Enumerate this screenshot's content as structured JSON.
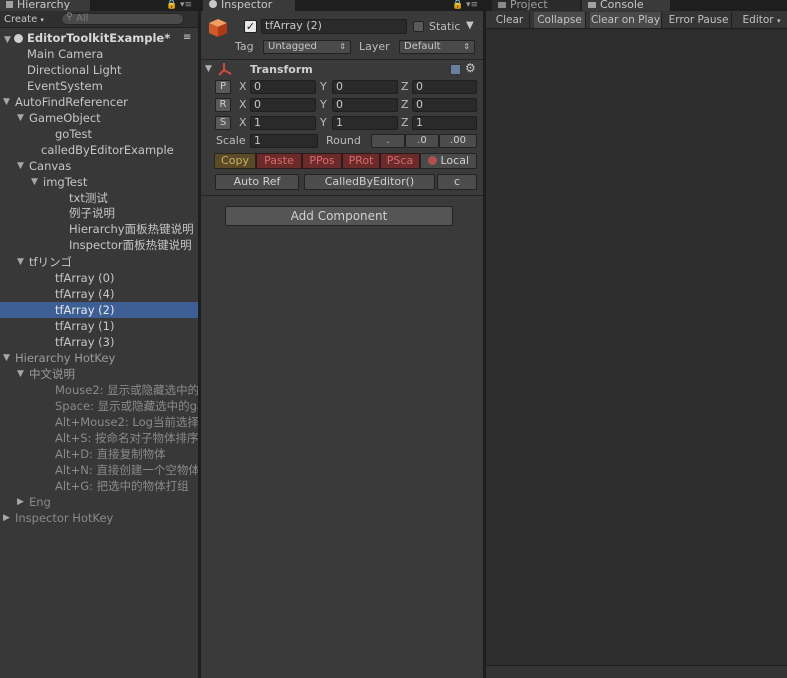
{
  "hierarchy": {
    "tab_label": "Hierarchy",
    "create_label": "Create",
    "search_placeholder": "All",
    "scene_name": "EditorToolkitExample*",
    "rows": [
      {
        "label": "Main Camera"
      },
      {
        "label": "Directional Light"
      },
      {
        "label": "EventSystem"
      },
      {
        "label": "AutoFindReferencer"
      },
      {
        "label": "GameObject"
      },
      {
        "label": "goTest"
      },
      {
        "label": "calledByEditorExample"
      },
      {
        "label": "Canvas"
      },
      {
        "label": "imgTest"
      },
      {
        "label": "txt测试"
      },
      {
        "label": "例子说明"
      },
      {
        "label": "Hierarchy面板热键说明"
      },
      {
        "label": "Inspector面板热键说明"
      },
      {
        "label": "tfリンゴ"
      },
      {
        "label": "tfArray (0)"
      },
      {
        "label": "tfArray (4)"
      },
      {
        "label": "tfArray (2)"
      },
      {
        "label": "tfArray (1)"
      },
      {
        "label": "tfArray (3)"
      },
      {
        "label": "Hierarchy HotKey"
      },
      {
        "label": "中文说明"
      },
      {
        "label": "Mouse2: 显示或隐藏选中的..."
      },
      {
        "label": "Space: 显示或隐藏选中的ga..."
      },
      {
        "label": "Alt+Mouse2: Log当前选择物..."
      },
      {
        "label": "Alt+S: 按命名对子物体排序"
      },
      {
        "label": "Alt+D: 直接复制物体"
      },
      {
        "label": "Alt+N: 直接创建一个空物体"
      },
      {
        "label": "Alt+G: 把选中的物体打组"
      },
      {
        "label": "Eng"
      },
      {
        "label": "Inspector HotKey"
      }
    ]
  },
  "inspector": {
    "tab_label": "Inspector",
    "object_name": "tfArray (2)",
    "static_label": "Static",
    "tag_label": "Tag",
    "tag_value": "Untagged",
    "layer_label": "Layer",
    "layer_value": "Default",
    "transform_label": "Transform",
    "position": {
      "btn": "P",
      "x": "0",
      "y": "0",
      "z": "0"
    },
    "rotation": {
      "btn": "R",
      "x": "0",
      "y": "0",
      "z": "0"
    },
    "scale": {
      "btn": "S",
      "x": "1",
      "y": "1",
      "z": "1"
    },
    "axis_x": "X",
    "axis_y": "Y",
    "axis_z": "Z",
    "scale_label": "Scale",
    "scale_value": "1",
    "round_label": "Round",
    "round_options": [
      ".",
      ".0",
      ".00"
    ],
    "copy_label": "Copy",
    "paste_label": "Paste",
    "ppos_label": "PPos",
    "prot_label": "PRot",
    "psca_label": "PSca",
    "local_label": "Local",
    "auto_ref_label": "Auto Ref",
    "called_by_editor_label": "CalledByEditor()",
    "c_label": "c",
    "add_component_label": "Add Component"
  },
  "console": {
    "project_tab": "Project",
    "console_tab": "Console",
    "buttons": [
      "Clear",
      "Collapse",
      "Clear on Play",
      "Error Pause",
      "Editor"
    ]
  },
  "colors": {
    "selection": "#3e5f96",
    "panel": "#3a3a3a",
    "red_button": "#6b2b2b",
    "copy_button": "#5a4a28"
  }
}
